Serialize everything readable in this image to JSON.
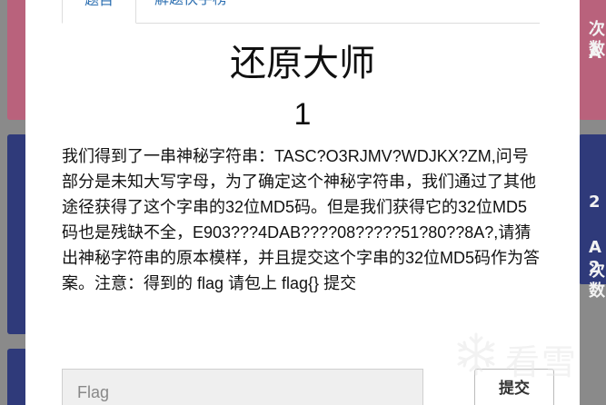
{
  "tabs": [
    {
      "label": "题目",
      "active": true
    },
    {
      "label": "解题快手榜",
      "active": false
    }
  ],
  "challenge": {
    "title": "还原大师",
    "points": "1",
    "description": "我们得到了一串神秘字符串：TASC?O3RJMV?WDJKX?ZM,问号部分是未知大写字母，为了确定这个神秘字符串，我们通过了其他途径获得了这个字串的32位MD5码。但是我们获得它的32位MD5码也是残缺不全，E903???4DAB????08?????51?80??8A?,请猜出神秘字符串的原本模样，并且提交这个字串的32位MD5码作为答案。注意：得到的 flag 请包上 flag{} 提交"
  },
  "form": {
    "flag_placeholder": "Flag",
    "flag_value": "",
    "submit_label": "提交"
  },
  "background": {
    "snippets": [
      "次数",
      "A",
      "2",
      "A 2",
      "次数"
    ]
  },
  "watermark": {
    "text": "看雪"
  },
  "colors": {
    "accent": "#2c6fb1",
    "backdrop": "#8a8a8a",
    "card_pink": "#b9627c",
    "card_navy": "#2f3a7a"
  }
}
